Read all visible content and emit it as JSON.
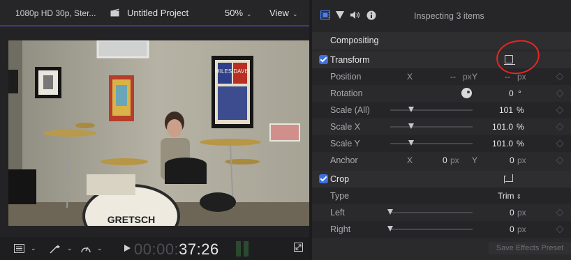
{
  "viewer": {
    "format": "1080p HD 30p, Ster...",
    "project_title": "Untitled Project",
    "zoom": "50%",
    "view_label": "View",
    "timecode_dim": "00:00:",
    "timecode_lit": "37:26"
  },
  "video_frame": {
    "drum_brand": "GRETSCH",
    "poster_text": "MILES DAVIS"
  },
  "inspector": {
    "title": "Inspecting 3 items",
    "compositing_label": "Compositing",
    "transform": {
      "label": "Transform",
      "position": {
        "label": "Position",
        "x_axis": "X",
        "x_value": "--",
        "x_unit": "px",
        "y_axis": "Y",
        "y_value": "--",
        "y_unit": "px"
      },
      "rotation": {
        "label": "Rotation",
        "value": "0",
        "unit": "°"
      },
      "scale_all": {
        "label": "Scale (All)",
        "value": "101",
        "unit": "%",
        "level": 0.25
      },
      "scale_x": {
        "label": "Scale X",
        "value": "101.0",
        "unit": "%",
        "level": 0.25
      },
      "scale_y": {
        "label": "Scale Y",
        "value": "101.0",
        "unit": "%",
        "level": 0.25
      },
      "anchor": {
        "label": "Anchor",
        "x_axis": "X",
        "x_value": "0",
        "x_unit": "px",
        "y_axis": "Y",
        "y_value": "0",
        "y_unit": "px"
      }
    },
    "crop": {
      "label": "Crop",
      "type": {
        "label": "Type",
        "value": "Trim"
      },
      "left": {
        "label": "Left",
        "value": "0",
        "unit": "px",
        "level": 0.0
      },
      "right": {
        "label": "Right",
        "value": "0",
        "unit": "px",
        "level": 0.0
      }
    },
    "save_button": "Save Effects Preset"
  },
  "colors": {
    "accent_blue": "#3c6fe0",
    "annotation_red": "#e8261f",
    "panel": "#2a2a2d"
  }
}
